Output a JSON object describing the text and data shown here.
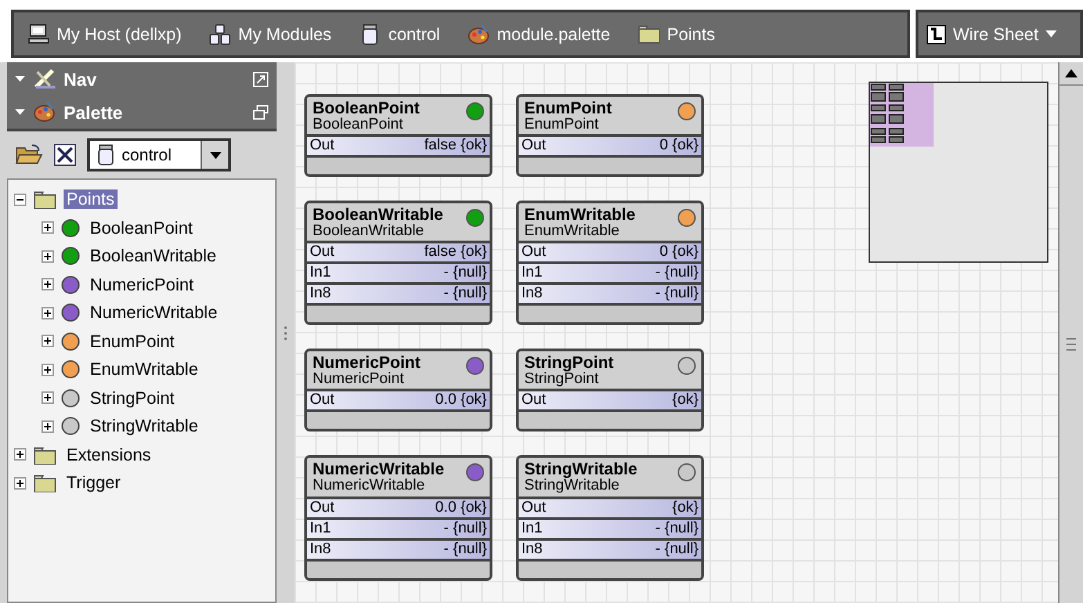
{
  "breadcrumb": [
    {
      "label": "My Host (dellxp)",
      "kind": "host"
    },
    {
      "label": "My Modules",
      "kind": "modules"
    },
    {
      "label": "control",
      "kind": "jar"
    },
    {
      "label": "module.palette",
      "kind": "palette"
    },
    {
      "label": "Points",
      "kind": "folder"
    }
  ],
  "view_selector": {
    "label": "Wire Sheet"
  },
  "sidebar": {
    "panels": [
      {
        "title": "Nav",
        "kind": "nav"
      },
      {
        "title": "Palette",
        "kind": "palette"
      }
    ],
    "palette_module": {
      "value": "control"
    },
    "tree": [
      {
        "label": "Points",
        "kind": "folder",
        "selected": true,
        "expanded": true,
        "children": [
          {
            "label": "BooleanPoint",
            "kind": "point",
            "color": "#12a012",
            "selected": false,
            "expanded": false
          },
          {
            "label": "BooleanWritable",
            "kind": "point",
            "color": "#12a012",
            "selected": false,
            "expanded": false
          },
          {
            "label": "NumericPoint",
            "kind": "point",
            "color": "#8a5cc8",
            "selected": false,
            "expanded": false
          },
          {
            "label": "NumericWritable",
            "kind": "point",
            "color": "#8a5cc8",
            "selected": false,
            "expanded": false
          },
          {
            "label": "EnumPoint",
            "kind": "point",
            "color": "#f0a050",
            "selected": false,
            "expanded": false
          },
          {
            "label": "EnumWritable",
            "kind": "point",
            "color": "#f0a050",
            "selected": false,
            "expanded": false
          },
          {
            "label": "StringPoint",
            "kind": "point",
            "color": "#c8c8c8",
            "selected": false,
            "expanded": false
          },
          {
            "label": "StringWritable",
            "kind": "point",
            "color": "#c8c8c8",
            "selected": false,
            "expanded": false
          }
        ]
      },
      {
        "label": "Extensions",
        "kind": "folder",
        "selected": false,
        "expanded": false
      },
      {
        "label": "Trigger",
        "kind": "folder",
        "selected": false,
        "expanded": false
      }
    ]
  },
  "wire_sheet": {
    "components": [
      {
        "name": "BooleanPoint",
        "type": "BooleanPoint",
        "color": "#12a012",
        "slots": [
          {
            "name": "Out",
            "value": "false {ok}"
          }
        ]
      },
      {
        "name": "EnumPoint",
        "type": "EnumPoint",
        "color": "#f0a050",
        "slots": [
          {
            "name": "Out",
            "value": "0 {ok}"
          }
        ]
      },
      {
        "name": "BooleanWritable",
        "type": "BooleanWritable",
        "color": "#12a012",
        "slots": [
          {
            "name": "Out",
            "value": "false {ok}"
          },
          {
            "name": "In1",
            "value": "- {null}"
          },
          {
            "name": "In8",
            "value": "- {null}"
          }
        ]
      },
      {
        "name": "EnumWritable",
        "type": "EnumWritable",
        "color": "#f0a050",
        "slots": [
          {
            "name": "Out",
            "value": "0 {ok}"
          },
          {
            "name": "In1",
            "value": "- {null}"
          },
          {
            "name": "In8",
            "value": "- {null}"
          }
        ]
      },
      {
        "name": "NumericPoint",
        "type": "NumericPoint",
        "color": "#8a5cc8",
        "slots": [
          {
            "name": "Out",
            "value": "0.0 {ok}"
          }
        ]
      },
      {
        "name": "StringPoint",
        "type": "StringPoint",
        "color": "#c8c8c8",
        "slots": [
          {
            "name": "Out",
            "value": "{ok}"
          }
        ]
      },
      {
        "name": "NumericWritable",
        "type": "NumericWritable",
        "color": "#8a5cc8",
        "slots": [
          {
            "name": "Out",
            "value": "0.0 {ok}"
          },
          {
            "name": "In1",
            "value": "- {null}"
          },
          {
            "name": "In8",
            "value": "- {null}"
          }
        ]
      },
      {
        "name": "StringWritable",
        "type": "StringWritable",
        "color": "#c8c8c8",
        "slots": [
          {
            "name": "Out",
            "value": "{ok}"
          },
          {
            "name": "In1",
            "value": "- {null}"
          },
          {
            "name": "In8",
            "value": "- {null}"
          }
        ]
      }
    ]
  }
}
